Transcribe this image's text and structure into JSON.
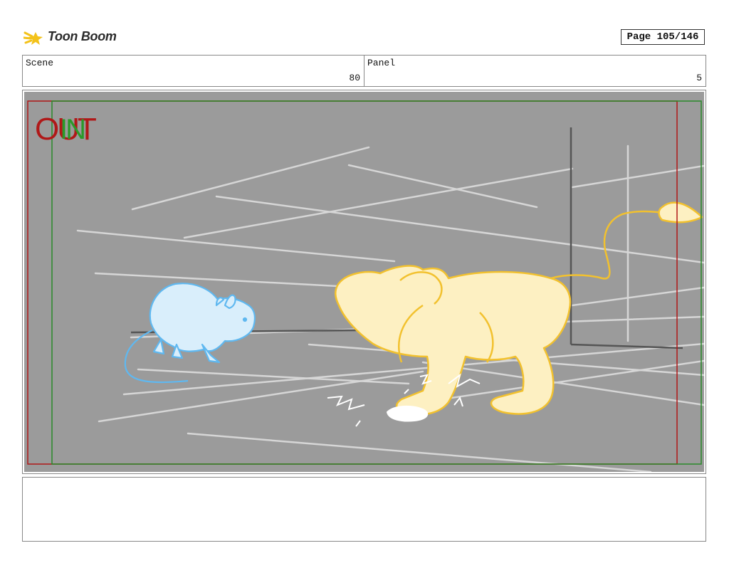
{
  "header": {
    "logo_text": "Toon Boom",
    "page_label": "Page 105/146"
  },
  "info": {
    "scene_label": "Scene",
    "scene_value": "80",
    "panel_label": "Panel",
    "panel_value": "5"
  },
  "frame": {
    "out_label": "OUT",
    "in_label": "IN",
    "colors": {
      "background": "#9b9b9b",
      "out_frame": "#b01818",
      "in_frame": "#2a8a2a",
      "mouse": "#5fb8f0",
      "lion": "#f2c12e"
    },
    "characters": [
      "mouse",
      "lion"
    ]
  },
  "notes": {
    "text": ""
  }
}
